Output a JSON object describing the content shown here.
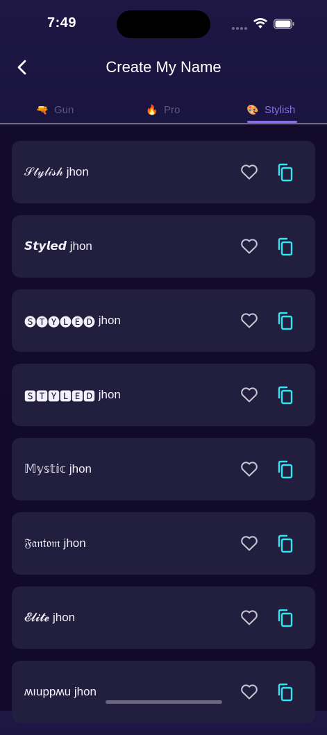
{
  "status": {
    "time": "7:49"
  },
  "header": {
    "title": "Create My Name"
  },
  "tabs": [
    {
      "emoji": "🔫",
      "label": "Gun"
    },
    {
      "emoji": "🔥",
      "label": "Pro"
    },
    {
      "emoji": "🎨",
      "label": "Stylish"
    }
  ],
  "items": [
    {
      "styled": "𝒮𝓉𝓎𝓁𝒾𝓈𝒽",
      "name": "jhon"
    },
    {
      "styled": "𝙎𝙩𝙮𝙡𝙚𝙙",
      "name": "jhon"
    },
    {
      "styled": "🅢🅣🅨🅛🅔🅓",
      "name": "jhon"
    },
    {
      "styled": "🆂🆃🆈🅻🅴🅳",
      "name": "jhon"
    },
    {
      "styled": "𝕄𝕪𝕤𝕥𝕚𝕔",
      "name": "jhon"
    },
    {
      "styled": "𝔉𝔞𝔫𝔱𝔬𝔪",
      "name": "jhon"
    },
    {
      "styled": "𝓔𝓵𝓲𝓽𝓮",
      "name": "jhon"
    },
    {
      "styled": "ʍıuppʍu",
      "name": "jhon"
    }
  ],
  "colors": {
    "accent": "#8a6fe8",
    "copy": "#2ee6f0",
    "card": "#221e3e"
  }
}
